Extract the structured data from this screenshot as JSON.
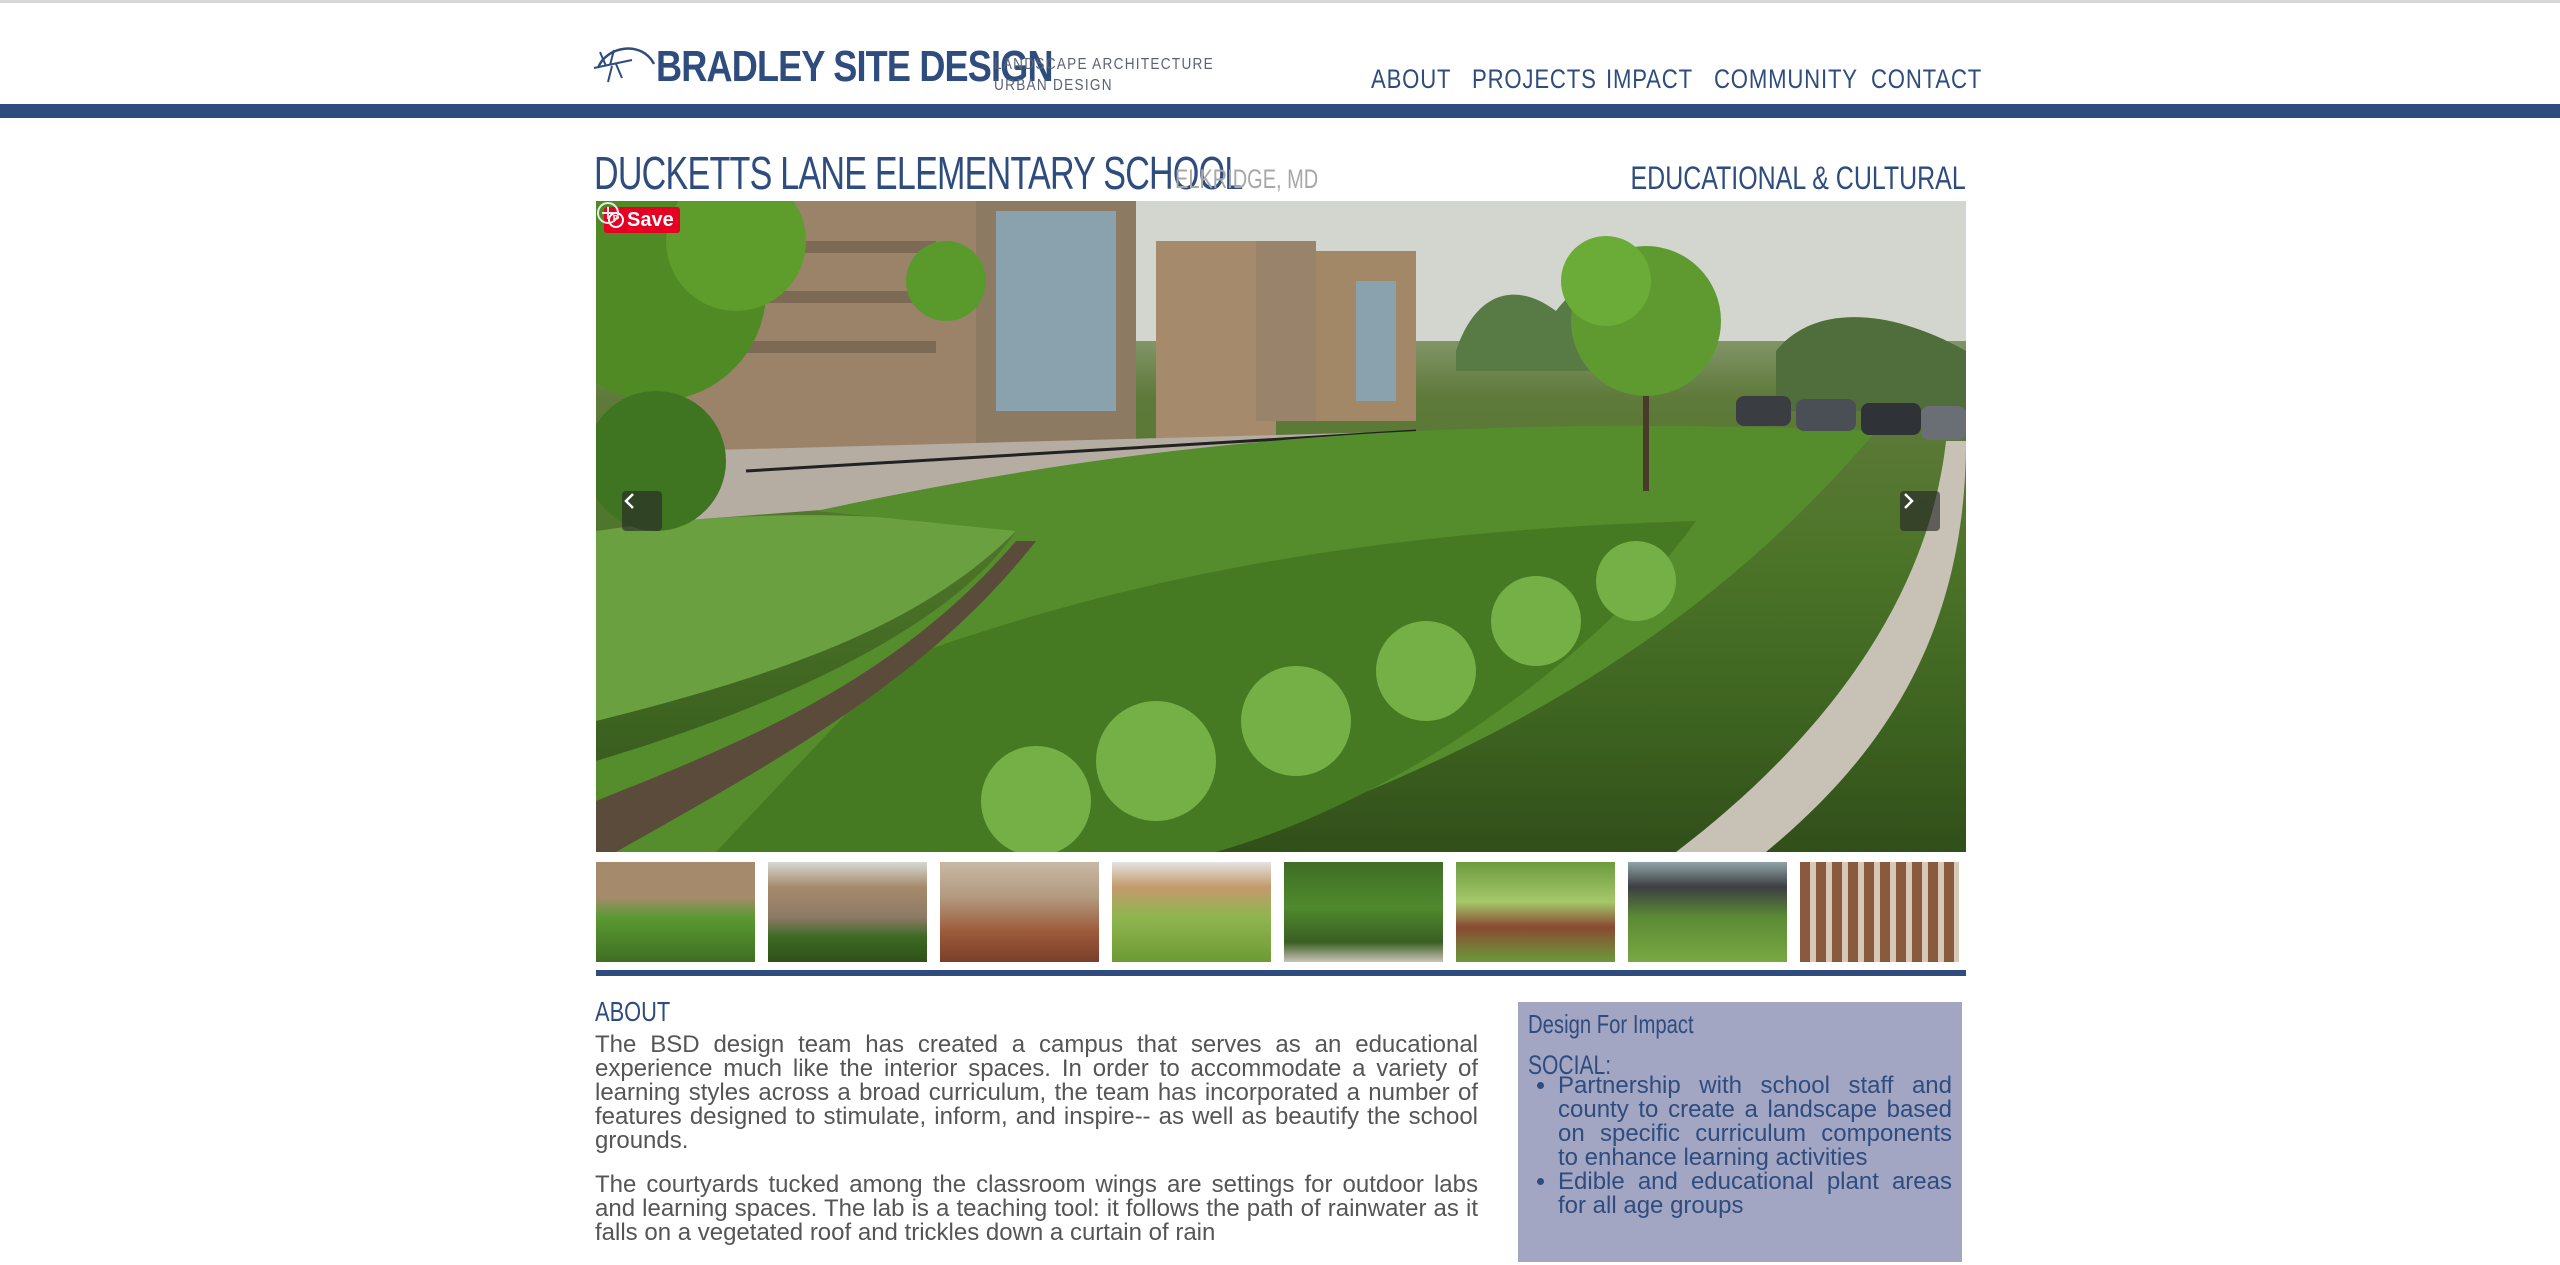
{
  "brand": {
    "name": "BRADLEY SITE DESIGN",
    "tagline_1": "LANDSCAPE ARCHITECTURE",
    "tagline_2": "URBAN DESIGN"
  },
  "nav": [
    {
      "label": "ABOUT"
    },
    {
      "label": "PROJECTS"
    },
    {
      "label": "IMPACT"
    },
    {
      "label": "COMMUNITY"
    },
    {
      "label": "CONTACT"
    }
  ],
  "project": {
    "title": "DUCKETTS LANE ELEMENTARY SCHOOL",
    "location": "ELKRIDGE, MD",
    "category": "EDUCATIONAL & CULTURAL"
  },
  "gallery": {
    "save_label": "Save",
    "thumbnail_count": 8
  },
  "about": {
    "heading": "ABOUT",
    "paragraphs": [
      "The BSD design team has created a campus that serves as an educational experience much like the interior spaces. In order to accommodate a variety of learning styles across a broad curriculum, the team has incorporated a number of features designed to stimulate, inform, and inspire-- as well as beautify the school grounds.",
      "The courtyards tucked among the classroom wings are settings for outdoor labs and learning spaces. The lab is a teaching tool: it follows the path of rainwater as it falls on a vegetated roof and trickles down a curtain of rain"
    ]
  },
  "impact": {
    "heading": "Design For Impact",
    "subheading": "SOCIAL:",
    "items": [
      "Partnership with school staff and county to create a landscape based on specific curriculum components to enhance learning activities",
      "Edible and educational plant areas for all age groups"
    ]
  },
  "colors": {
    "brand_blue": "#2e4c7e",
    "impact_bg": "#a3a6c3",
    "pinterest_red": "#e60023"
  }
}
